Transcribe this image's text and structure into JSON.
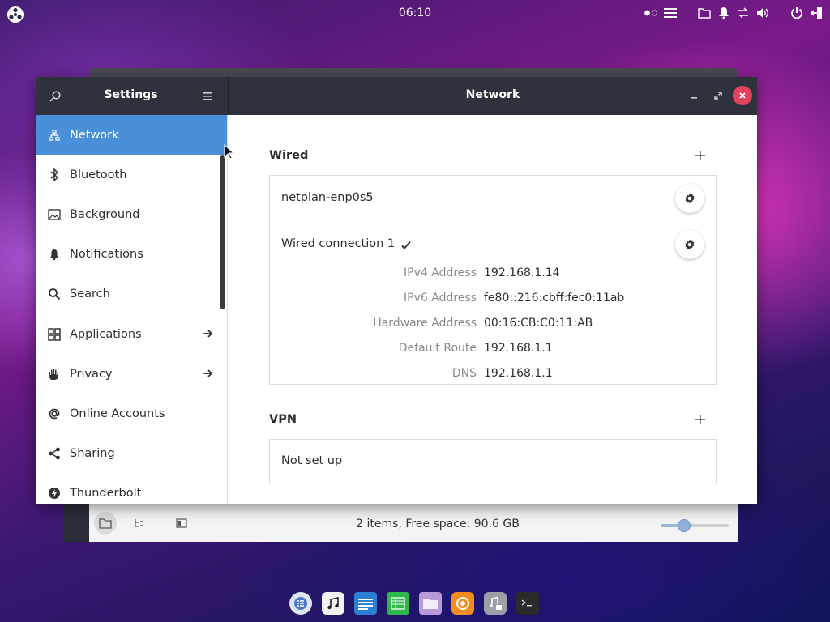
{
  "topbar": {
    "clock": "06:10"
  },
  "settings_window": {
    "sidebar_title": "Settings",
    "main_title": "Network",
    "sidebar_items": [
      {
        "label": "Network",
        "icon": "network-icon",
        "selected": true,
        "arrow": false
      },
      {
        "label": "Bluetooth",
        "icon": "bluetooth-icon",
        "selected": false,
        "arrow": false
      },
      {
        "label": "Background",
        "icon": "image-icon",
        "selected": false,
        "arrow": false
      },
      {
        "label": "Notifications",
        "icon": "bell-icon",
        "selected": false,
        "arrow": false
      },
      {
        "label": "Search",
        "icon": "search-icon",
        "selected": false,
        "arrow": false
      },
      {
        "label": "Applications",
        "icon": "apps-grid-icon",
        "selected": false,
        "arrow": true
      },
      {
        "label": "Privacy",
        "icon": "hand-icon",
        "selected": false,
        "arrow": true
      },
      {
        "label": "Online Accounts",
        "icon": "at-icon",
        "selected": false,
        "arrow": false
      },
      {
        "label": "Sharing",
        "icon": "share-icon",
        "selected": false,
        "arrow": false
      },
      {
        "label": "Thunderbolt",
        "icon": "thunderbolt-icon",
        "selected": false,
        "arrow": false
      }
    ],
    "wired": {
      "title": "Wired",
      "connections": [
        {
          "name": "netplan-enp0s5",
          "active": false
        },
        {
          "name": "Wired connection 1",
          "active": true
        }
      ],
      "details": [
        {
          "label": "IPv4 Address",
          "value": "192.168.1.14"
        },
        {
          "label": "IPv6 Address",
          "value": "fe80::216:cbff:fec0:11ab"
        },
        {
          "label": "Hardware Address",
          "value": "00:16:CB:C0:11:AB"
        },
        {
          "label": "Default Route",
          "value": "192.168.1.1"
        },
        {
          "label": "DNS",
          "value": "192.168.1.1"
        }
      ]
    },
    "vpn": {
      "title": "VPN",
      "status": "Not set up"
    }
  },
  "file_manager": {
    "status": "2 items, Free space: 90.6 GB",
    "zoom_fraction": 0.35
  },
  "dock": {
    "apps": [
      "launcher-icon",
      "music-icon",
      "text-editor-icon",
      "spreadsheet-icon",
      "files-icon",
      "firefox-icon",
      "media-icon",
      "terminal-icon"
    ]
  },
  "colors": {
    "accent": "#4a90d9",
    "titlebar": "#2f313d",
    "close": "#e0435a"
  }
}
